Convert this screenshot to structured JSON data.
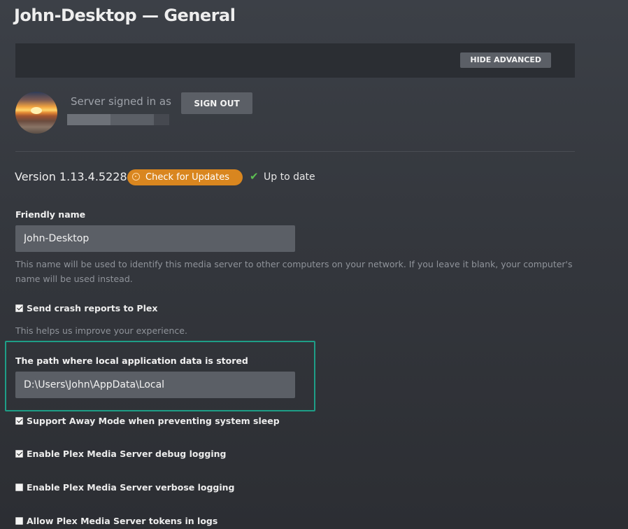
{
  "header": {
    "title": "John-Desktop — General"
  },
  "advanced_bar": {
    "hide_advanced_label": "HIDE ADVANCED"
  },
  "account": {
    "signed_in_label": "Server signed in as",
    "sign_out_label": "SIGN OUT"
  },
  "version": {
    "text": "Version 1.13.4.5228",
    "check_updates_label": "Check for Updates",
    "status_text": "Up to date"
  },
  "friendly_name": {
    "label": "Friendly name",
    "value": "John-Desktop",
    "help": "This name will be used to identify this media server to other computers on your network. If you leave it blank, your computer's name will be used instead."
  },
  "crash_reports": {
    "label": "Send crash reports to Plex",
    "checked": true,
    "help": "This helps us improve your experience."
  },
  "data_path": {
    "label": "The path where local application data is stored",
    "value": "D:\\Users\\John\\AppData\\Local"
  },
  "options": {
    "away_mode": {
      "label": "Support Away Mode when preventing system sleep",
      "checked": true
    },
    "debug_logging": {
      "label": "Enable Plex Media Server debug logging",
      "checked": true
    },
    "verbose_logging": {
      "label": "Enable Plex Media Server verbose logging",
      "checked": false
    },
    "tokens_in_logs": {
      "label": "Allow Plex Media Server tokens in logs",
      "checked": false
    }
  },
  "colors": {
    "accent_orange": "#d9861f",
    "highlight_teal": "#1e9e87",
    "status_green": "#5cbf52"
  }
}
